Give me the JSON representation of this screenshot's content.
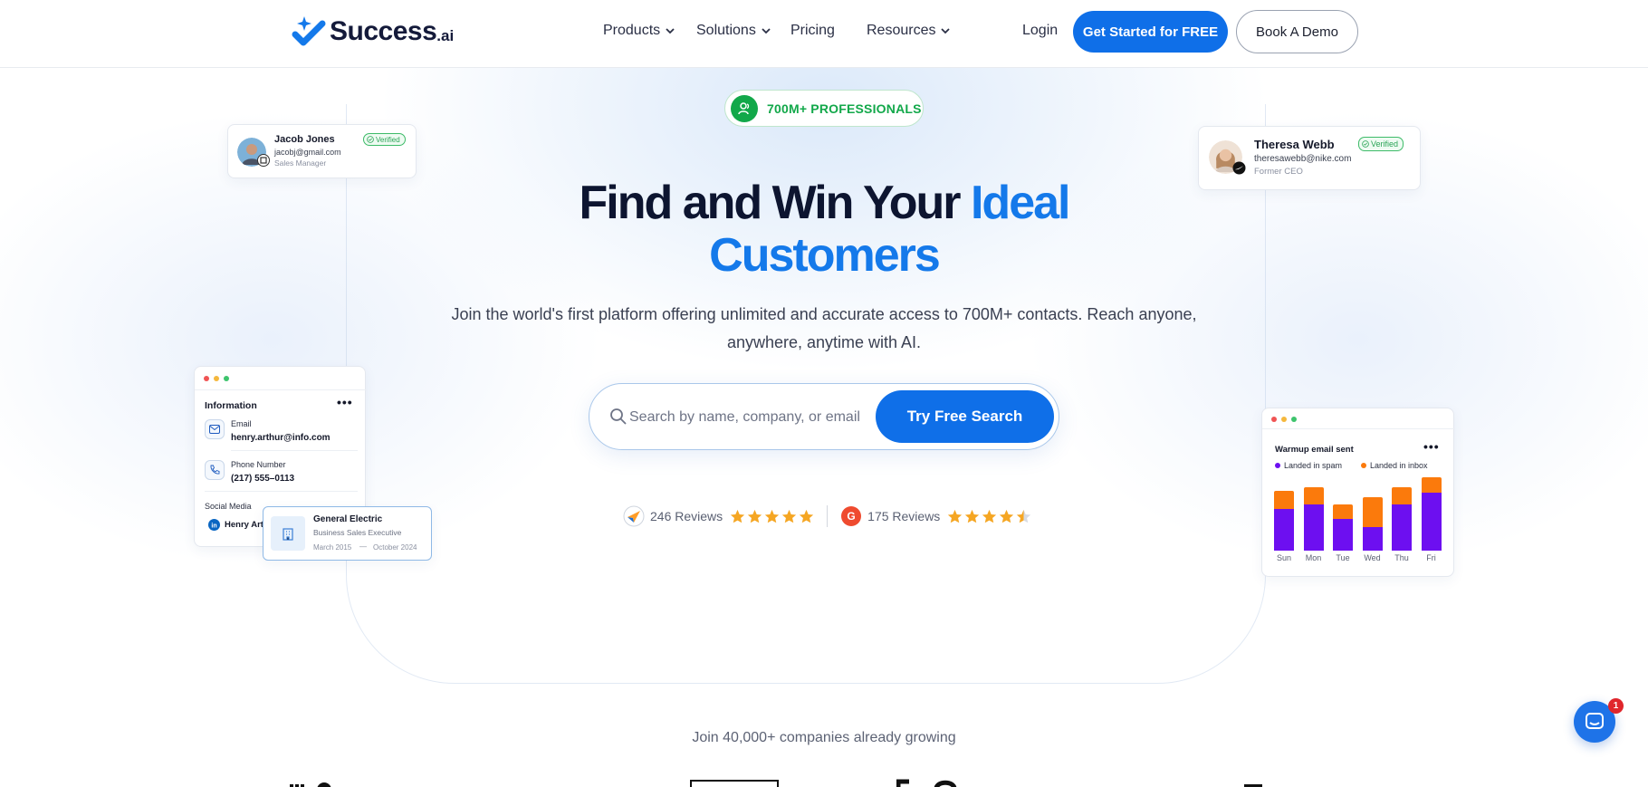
{
  "brand": {
    "name": "Success",
    "suffix": ".ai",
    "accent_color": "#0f6fe8",
    "logo_icon": "checkmark-sparkle-icon"
  },
  "nav": {
    "items": [
      {
        "label": "Products",
        "has_dropdown": true
      },
      {
        "label": "Solutions",
        "has_dropdown": true
      },
      {
        "label": "Pricing",
        "has_dropdown": false
      },
      {
        "label": "Resources",
        "has_dropdown": true
      }
    ],
    "login": "Login",
    "cta_primary": "Get Started for FREE",
    "cta_secondary": "Book A Demo"
  },
  "hero": {
    "badge": "700M+ PROFESSIONALS",
    "headline_dark": "Find and Win Your",
    "headline_accent_1": "Ideal",
    "headline_accent_2": "Customers",
    "subline_1": "Join the world's first platform offering unlimited and accurate access to 700M+ contacts. Reach anyone,",
    "subline_2": "anywhere, anytime with AI.",
    "search_placeholder": "Search by name, company, or email",
    "search_button": "Try Free Search"
  },
  "reviews": [
    {
      "count_label": "246 Reviews",
      "rating": 5,
      "source_icon": "capterra-icon"
    },
    {
      "count_label": "175 Reviews",
      "rating": 4.5,
      "source_icon": "g2-icon"
    }
  ],
  "cards": {
    "jacob": {
      "name": "Jacob Jones",
      "email": "jacobj@gmail.com",
      "role": "Sales Manager",
      "verified": "Verified"
    },
    "theresa": {
      "name": "Theresa Webb",
      "email": "theresawebb@nike.com",
      "role": "Former CEO",
      "verified": "Verified"
    },
    "info": {
      "title": "Information",
      "email_label": "Email",
      "email_value": "henry.arthur@info.com",
      "phone_label": "Phone Number",
      "phone_value": "(217) 555–0113",
      "social_label": "Social Media",
      "social_value": "Henry Arthur"
    },
    "company": {
      "name": "General Electric",
      "role": "Business Sales Executive",
      "start": "March 2015",
      "end": "October 2024"
    },
    "warmup": {
      "title": "Warmup email sent",
      "legend": [
        "Landed in spam",
        "Landed in inbox"
      ]
    }
  },
  "chart_data": {
    "type": "bar",
    "stacked": true,
    "title": "Warmup email sent",
    "categories": [
      "Sun",
      "Mon",
      "Tue",
      "Wed",
      "Thu",
      "Fri"
    ],
    "series": [
      {
        "name": "Landed in spam",
        "color": "#6d0ff0",
        "values": [
          42,
          46,
          32,
          24,
          46,
          58
        ]
      },
      {
        "name": "Landed in inbox",
        "color": "#fb7a0c",
        "values": [
          18,
          18,
          14,
          30,
          18,
          16
        ]
      }
    ]
  },
  "social_proof": {
    "text": "Join 40,000+ companies already growing"
  },
  "chat": {
    "badge_count": "1"
  }
}
